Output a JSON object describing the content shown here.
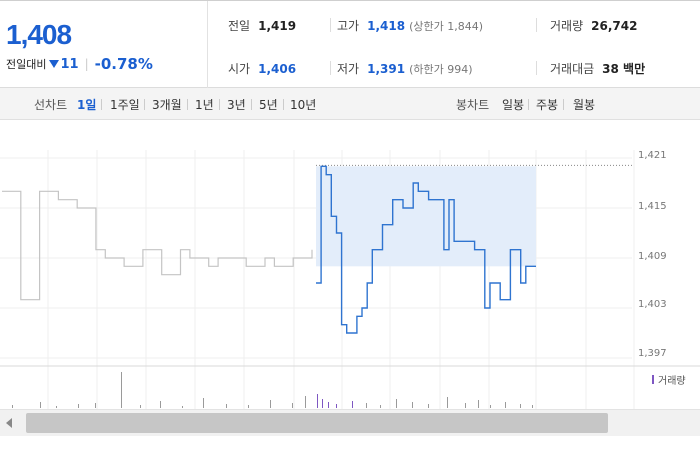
{
  "quote": {
    "price": "1,408",
    "change_label": "전일대비",
    "change_amount": "11",
    "change_pct": "-0.78%"
  },
  "stats": {
    "prev_close_label": "전일",
    "prev_close": "1,419",
    "high_label": "고가",
    "high": "1,418",
    "upper_limit": "(상한가 1,844)",
    "volume_label": "거래량",
    "volume": "26,742",
    "open_label": "시가",
    "open": "1,406",
    "low_label": "저가",
    "low": "1,391",
    "lower_limit": "(하한가 994)",
    "amount_label": "거래대금",
    "amount": "38 백만"
  },
  "line_tabs": {
    "label": "선차트",
    "items": [
      "1일",
      "1주일",
      "3개월",
      "1년",
      "3년",
      "5년",
      "10년"
    ],
    "selected": "1일"
  },
  "candle_tabs": {
    "label": "봉차트",
    "items": [
      "일봉",
      "주봉",
      "월봉"
    ]
  },
  "chart_data": {
    "type": "line",
    "y_ticks": [
      "1,421",
      "1,415",
      "1,409",
      "1,403",
      "1,397"
    ],
    "ylim": [
      1397,
      1421
    ],
    "legend": "거래량",
    "grid": true,
    "colors": {
      "prev": "#c4c4c4",
      "today": "#2f74d0",
      "fill": "#e3edfa",
      "volume": "#7e57c2"
    },
    "series": [
      {
        "values": [
          1417,
          1417,
          1404,
          1404,
          1417,
          1417,
          1416,
          1416,
          1415,
          1415,
          1410,
          1409,
          1409,
          1408,
          1408,
          1410,
          1410,
          1407,
          1407,
          1410,
          1409,
          1409,
          1408,
          1409,
          1409,
          1409,
          1408,
          1408,
          1409,
          1408,
          1408,
          1409,
          1409,
          1410
        ]
      },
      {
        "values": [
          1406,
          1420,
          1419,
          1414,
          1412,
          1401,
          1400,
          1400,
          1402,
          1403,
          1406,
          1410,
          1410,
          1413,
          1413,
          1416,
          1416,
          1415,
          1415,
          1418,
          1417,
          1417,
          1416,
          1416,
          1416,
          1410,
          1416,
          1411,
          1411,
          1411,
          1411,
          1410,
          1410,
          1403,
          1406,
          1406,
          1404,
          1404,
          1410,
          1410,
          1406,
          1408,
          1408,
          1408
        ]
      }
    ]
  }
}
